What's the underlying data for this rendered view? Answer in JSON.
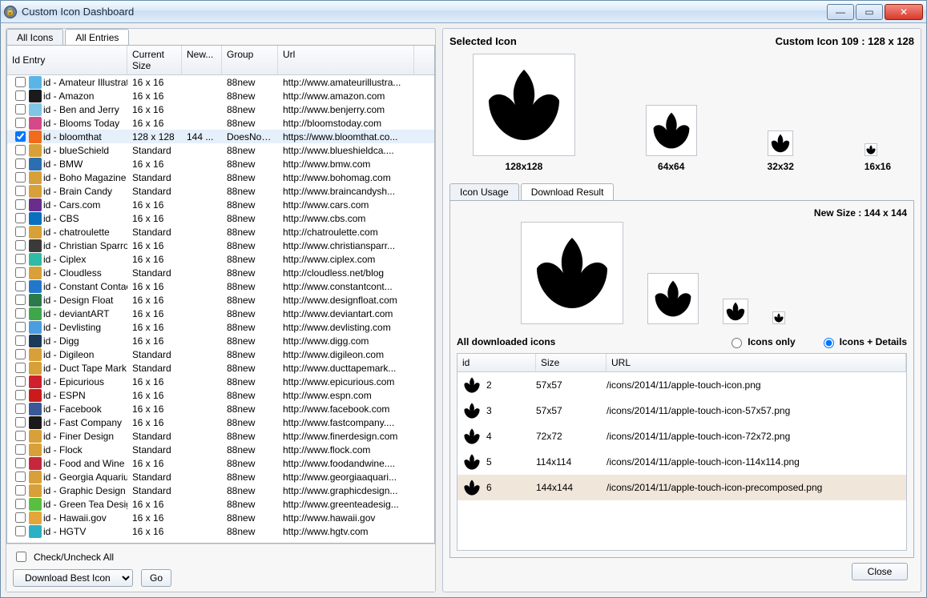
{
  "window": {
    "title": "Custom Icon Dashboard"
  },
  "left_tabs": [
    "All Icons",
    "All Entries"
  ],
  "left_active_tab": 1,
  "columns": [
    "Id Entry",
    "Current Size",
    "New...",
    "Group",
    "Url"
  ],
  "rows": [
    {
      "checked": false,
      "fav": "#5bb4e6",
      "id": "id - Amateur Illustrator",
      "size": "16 x 16",
      "new": "",
      "group": "88new",
      "url": "http://www.amateurillustra..."
    },
    {
      "checked": false,
      "fav": "#1a1a1a",
      "id": "id - Amazon",
      "size": "16 x 16",
      "new": "",
      "group": "88new",
      "url": "http://www.amazon.com"
    },
    {
      "checked": false,
      "fav": "#7fc6e6",
      "id": "id - Ben and Jerry",
      "size": "16 x 16",
      "new": "",
      "group": "88new",
      "url": "http://www.benjerry.com"
    },
    {
      "checked": false,
      "fav": "#d24a8a",
      "id": "id - Blooms Today",
      "size": "16 x 16",
      "new": "",
      "group": "88new",
      "url": "http://bloomstoday.com"
    },
    {
      "checked": true,
      "fav": "#f26a1b",
      "id": "id - bloomthat",
      "size": "128 x 128",
      "new": "144 ...",
      "group": "DoesNotW...",
      "url": "https://www.bloomthat.co...",
      "sel": true
    },
    {
      "checked": false,
      "fav": "#d8a038",
      "id": "id - blueSchield",
      "size": "Standard",
      "new": "",
      "group": "88new",
      "url": "http://www.blueshieldca...."
    },
    {
      "checked": false,
      "fav": "#2b6fb0",
      "id": "id - BMW",
      "size": "16 x 16",
      "new": "",
      "group": "88new",
      "url": "http://www.bmw.com"
    },
    {
      "checked": false,
      "fav": "#d8a038",
      "id": "id - Boho Magazine",
      "size": "Standard",
      "new": "",
      "group": "88new",
      "url": "http://www.bohomag.com"
    },
    {
      "checked": false,
      "fav": "#d8a038",
      "id": "id - Brain Candy",
      "size": "Standard",
      "new": "",
      "group": "88new",
      "url": "http://www.braincandysh..."
    },
    {
      "checked": false,
      "fav": "#6a2e8a",
      "id": "id - Cars.com",
      "size": "16 x 16",
      "new": "",
      "group": "88new",
      "url": "http://www.cars.com"
    },
    {
      "checked": false,
      "fav": "#0b6fc0",
      "id": "id - CBS",
      "size": "16 x 16",
      "new": "",
      "group": "88new",
      "url": "http://www.cbs.com"
    },
    {
      "checked": false,
      "fav": "#d8a038",
      "id": "id - chatroulette",
      "size": "Standard",
      "new": "",
      "group": "88new",
      "url": "http://chatroulette.com"
    },
    {
      "checked": false,
      "fav": "#3a3a3a",
      "id": "id - Christian Sparrow",
      "size": "16 x 16",
      "new": "",
      "group": "88new",
      "url": "http://www.christiansparr..."
    },
    {
      "checked": false,
      "fav": "#2fbba5",
      "id": "id - Ciplex",
      "size": "16 x 16",
      "new": "",
      "group": "88new",
      "url": "http://www.ciplex.com"
    },
    {
      "checked": false,
      "fav": "#d8a038",
      "id": "id - Cloudless",
      "size": "Standard",
      "new": "",
      "group": "88new",
      "url": "http://cloudless.net/blog"
    },
    {
      "checked": false,
      "fav": "#2277cc",
      "id": "id - Constant Contact",
      "size": "16 x 16",
      "new": "",
      "group": "88new",
      "url": "http://www.constantcont..."
    },
    {
      "checked": false,
      "fav": "#2c7a4c",
      "id": "id - Design Float",
      "size": "16 x 16",
      "new": "",
      "group": "88new",
      "url": "http://www.designfloat.com"
    },
    {
      "checked": false,
      "fav": "#3fa64c",
      "id": "id - deviantART",
      "size": "16 x 16",
      "new": "",
      "group": "88new",
      "url": "http://www.deviantart.com"
    },
    {
      "checked": false,
      "fav": "#4a9de0",
      "id": "id - Devlisting",
      "size": "16 x 16",
      "new": "",
      "group": "88new",
      "url": "http://www.devlisting.com"
    },
    {
      "checked": false,
      "fav": "#1a3a5a",
      "id": "id - Digg",
      "size": "16 x 16",
      "new": "",
      "group": "88new",
      "url": "http://www.digg.com"
    },
    {
      "checked": false,
      "fav": "#d8a038",
      "id": "id - Digileon",
      "size": "Standard",
      "new": "",
      "group": "88new",
      "url": "http://www.digileon.com"
    },
    {
      "checked": false,
      "fav": "#d8a038",
      "id": "id - Duct Tape Mark...",
      "size": "Standard",
      "new": "",
      "group": "88new",
      "url": "http://www.ducttapemark..."
    },
    {
      "checked": false,
      "fav": "#d0202c",
      "id": "id - Epicurious",
      "size": "16 x 16",
      "new": "",
      "group": "88new",
      "url": "http://www.epicurious.com"
    },
    {
      "checked": false,
      "fav": "#cc1a1a",
      "id": "id - ESPN",
      "size": "16 x 16",
      "new": "",
      "group": "88new",
      "url": "http://www.espn.com"
    },
    {
      "checked": false,
      "fav": "#3b5998",
      "id": "id - Facebook",
      "size": "16 x 16",
      "new": "",
      "group": "88new",
      "url": "http://www.facebook.com"
    },
    {
      "checked": false,
      "fav": "#1a1a1a",
      "id": "id - Fast Company",
      "size": "16 x 16",
      "new": "",
      "group": "88new",
      "url": "http://www.fastcompany...."
    },
    {
      "checked": false,
      "fav": "#d8a038",
      "id": "id - Finer Design",
      "size": "Standard",
      "new": "",
      "group": "88new",
      "url": "http://www.finerdesign.com"
    },
    {
      "checked": false,
      "fav": "#d8a038",
      "id": "id - Flock",
      "size": "Standard",
      "new": "",
      "group": "88new",
      "url": "http://www.flock.com"
    },
    {
      "checked": false,
      "fav": "#c8263c",
      "id": "id - Food and Wine ...",
      "size": "16 x 16",
      "new": "",
      "group": "88new",
      "url": "http://www.foodandwine...."
    },
    {
      "checked": false,
      "fav": "#d8a038",
      "id": "id - Georgia Aquarium",
      "size": "Standard",
      "new": "",
      "group": "88new",
      "url": "http://www.georgiaaquari..."
    },
    {
      "checked": false,
      "fav": "#d8a038",
      "id": "id - Graphic Design ...",
      "size": "Standard",
      "new": "",
      "group": "88new",
      "url": "http://www.graphicdesign..."
    },
    {
      "checked": false,
      "fav": "#5abf3f",
      "id": "id - Green Tea Design",
      "size": "16 x 16",
      "new": "",
      "group": "88new",
      "url": "http://www.greenteadesig..."
    },
    {
      "checked": false,
      "fav": "#e4a53a",
      "id": "id - Hawaii.gov",
      "size": "16 x 16",
      "new": "",
      "group": "88new",
      "url": "http://www.hawaii.gov"
    },
    {
      "checked": false,
      "fav": "#2bb0c4",
      "id": "id - HGTV",
      "size": "16 x 16",
      "new": "",
      "group": "88new",
      "url": "http://www.hgtv.com"
    }
  ],
  "checkall_label": "Check/Uncheck All",
  "download_options": [
    "Download Best Icon"
  ],
  "go_label": "Go",
  "selected_title": "Selected Icon",
  "selected_meta": "Custom Icon 109 : 128 x 128",
  "size_captions": [
    "128x128",
    "64x64",
    "32x32",
    "16x16"
  ],
  "mini_tabs": [
    "Icon Usage",
    "Download Result"
  ],
  "mini_active": 1,
  "new_size": "New Size : 144 x 144",
  "dl_title": "All downloaded icons",
  "radio_icons_only": "Icons only",
  "radio_icons_details": "Icons + Details",
  "dl_columns": [
    "id",
    "Size",
    "URL"
  ],
  "dl_rows": [
    {
      "id": "2",
      "size": "57x57",
      "url": "/icons/2014/11/apple-touch-icon.png"
    },
    {
      "id": "3",
      "size": "57x57",
      "url": "/icons/2014/11/apple-touch-icon-57x57.png"
    },
    {
      "id": "4",
      "size": "72x72",
      "url": "/icons/2014/11/apple-touch-icon-72x72.png"
    },
    {
      "id": "5",
      "size": "114x114",
      "url": "/icons/2014/11/apple-touch-icon-114x114.png"
    },
    {
      "id": "6",
      "size": "144x144",
      "url": "/icons/2014/11/apple-touch-icon-precomposed.png",
      "sel": true
    }
  ],
  "close_label": "Close"
}
